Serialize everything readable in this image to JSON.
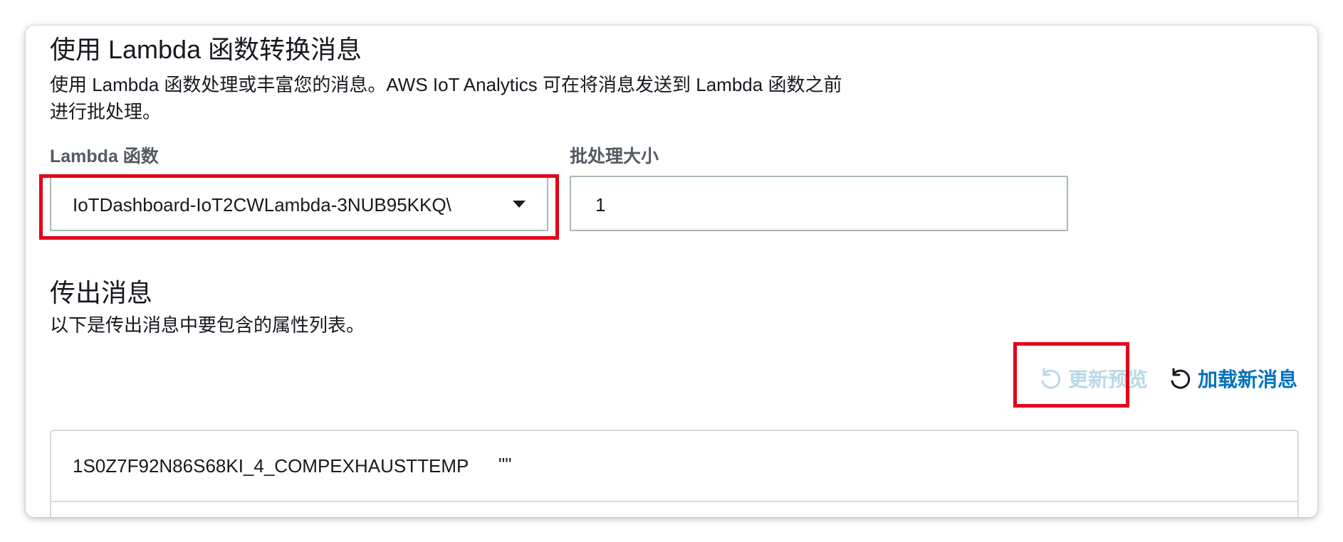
{
  "lambda_section": {
    "title": "使用 Lambda 函数转换消息",
    "description_line1": "使用 Lambda 函数处理或丰富您的消息。AWS IoT Analytics 可在将消息发送到 Lambda 函数之前",
    "description_line2": "进行批处理。",
    "function_label": "Lambda 函数",
    "function_value": "IoTDashboard-IoT2CWLambda-3NUB95KKQ\\",
    "batch_label": "批处理大小",
    "batch_value": "1"
  },
  "outgoing_section": {
    "title": "传出消息",
    "description": "以下是传出消息中要包含的属性列表。",
    "update_preview_label": "更新预览",
    "load_new_messages_label": "加载新消息",
    "attributes": [
      {
        "name": "1S0Z7F92N86S68KI_4_COMPEXHAUSTTEMP",
        "value": "\"\""
      }
    ]
  },
  "icons": {
    "dropdown": "caret-down-icon",
    "refresh": "refresh-icon"
  },
  "colors": {
    "highlight": "#e3001b",
    "link": "#0073bb",
    "disabled_link": "#b8d9e8",
    "label_gray": "#545b64"
  }
}
